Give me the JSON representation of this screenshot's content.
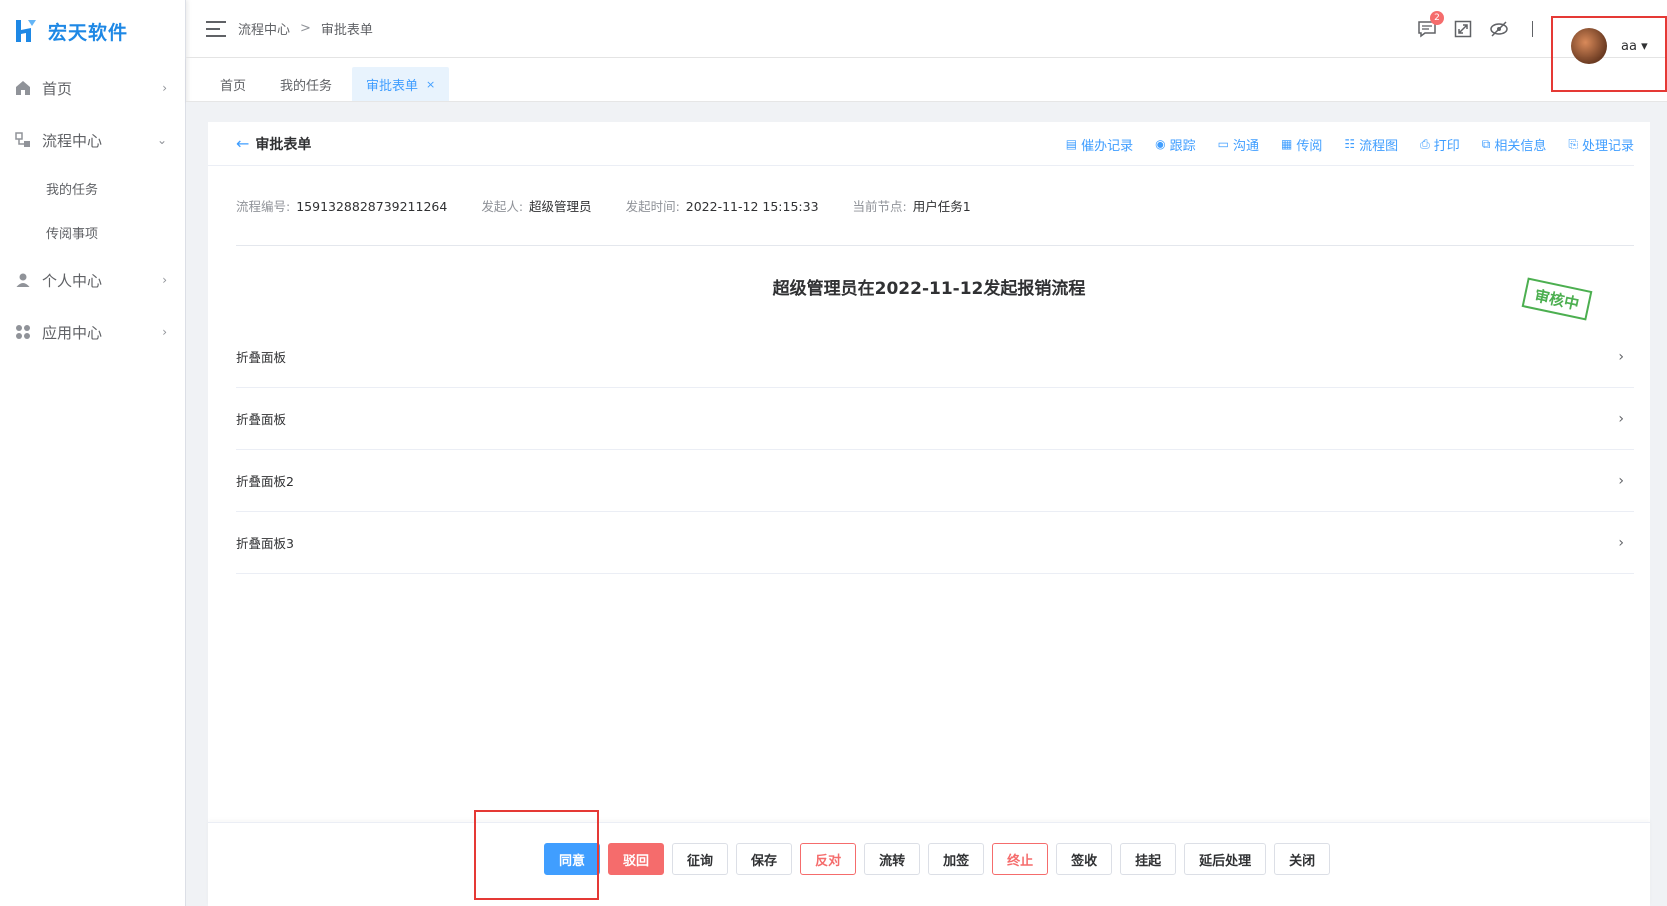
{
  "brand": {
    "name": "宏天软件",
    "color": "#1e88e5"
  },
  "sidebar": {
    "items": [
      {
        "label": "首页",
        "icon": "home-icon"
      },
      {
        "label": "流程中心",
        "icon": "flow-icon",
        "expanded": true,
        "children": [
          {
            "label": "我的任务"
          },
          {
            "label": "传阅事项"
          }
        ]
      },
      {
        "label": "个人中心",
        "icon": "user-icon"
      },
      {
        "label": "应用中心",
        "icon": "apps-icon"
      }
    ]
  },
  "header": {
    "breadcrumb": [
      "流程中心",
      "审批表单"
    ],
    "breadcrumb_sep": ">",
    "message_badge": "2",
    "username": "aa",
    "user_caret": "▾"
  },
  "tags": [
    {
      "label": "首页"
    },
    {
      "label": "我的任务"
    },
    {
      "label": "审批表单",
      "active": true,
      "close": "×"
    }
  ],
  "card": {
    "title": "审批表单",
    "actions": [
      "催办记录",
      "跟踪",
      "沟通",
      "传阅",
      "流程图",
      "打印",
      "相关信息",
      "处理记录"
    ],
    "info": {
      "flow_no_label": "流程编号:",
      "flow_no": "1591328828739211264",
      "initiator_label": "发起人:",
      "initiator": "超级管理员",
      "start_time_label": "发起时间:",
      "start_time": "2022-11-12 15:15:33",
      "node_label": "当前节点:",
      "node": "用户任务1"
    },
    "form_title": "超级管理员在2022-11-12发起报销流程",
    "stamp": "审核中",
    "panels": [
      "折叠面板",
      "折叠面板",
      "折叠面板2",
      "折叠面板3"
    ]
  },
  "footer": {
    "buttons": [
      "同意",
      "驳回",
      "征询",
      "保存",
      "反对",
      "流转",
      "加签",
      "终止",
      "签收",
      "挂起",
      "延后处理",
      "关闭"
    ]
  },
  "colors": {
    "primary": "#409eff",
    "danger": "#f56c6c",
    "highlight": "#e53935",
    "stamp": "#4caf50"
  }
}
